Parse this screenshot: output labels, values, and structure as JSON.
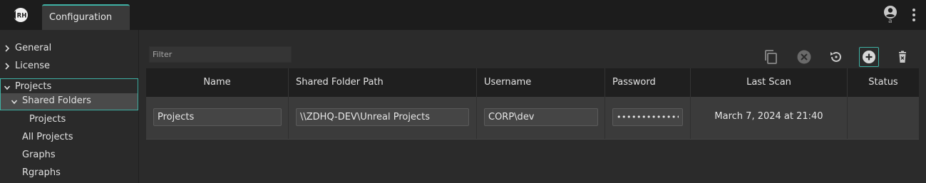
{
  "app": {
    "logo_text": "RH"
  },
  "tabs": [
    {
      "label": "Configuration",
      "active": true
    }
  ],
  "account": {
    "letter": "a",
    "icon": "account-circle-icon"
  },
  "sidebar": {
    "items": [
      {
        "label": "General",
        "expanded": false
      },
      {
        "label": "License",
        "expanded": false
      },
      {
        "label": "Projects",
        "expanded": true
      },
      {
        "label": "Shared Folders",
        "expanded": true,
        "selected": true
      },
      {
        "label": "Projects"
      },
      {
        "label": "All Projects"
      },
      {
        "label": "Graphs"
      },
      {
        "label": "Rgraphs"
      }
    ]
  },
  "filter": {
    "placeholder": "Filter",
    "value": ""
  },
  "toolbar": {
    "icons": [
      "copy-icon",
      "cancel-icon",
      "restore-icon",
      "add-icon",
      "delete-icon"
    ]
  },
  "table": {
    "columns": [
      "Name",
      "Shared Folder Path",
      "Username",
      "Password",
      "Last Scan",
      "Status"
    ],
    "rows": [
      {
        "name": "Projects",
        "path": "\\\\ZDHQ-DEV\\Unreal Projects",
        "username": "CORP\\dev",
        "password": "•••••••••••••",
        "last_scan": "March 7, 2024 at 21:40",
        "status": ""
      }
    ]
  },
  "colors": {
    "accent": "#3fb1a4",
    "topbar": "#1c1c1c",
    "background": "#2b2b2b"
  }
}
